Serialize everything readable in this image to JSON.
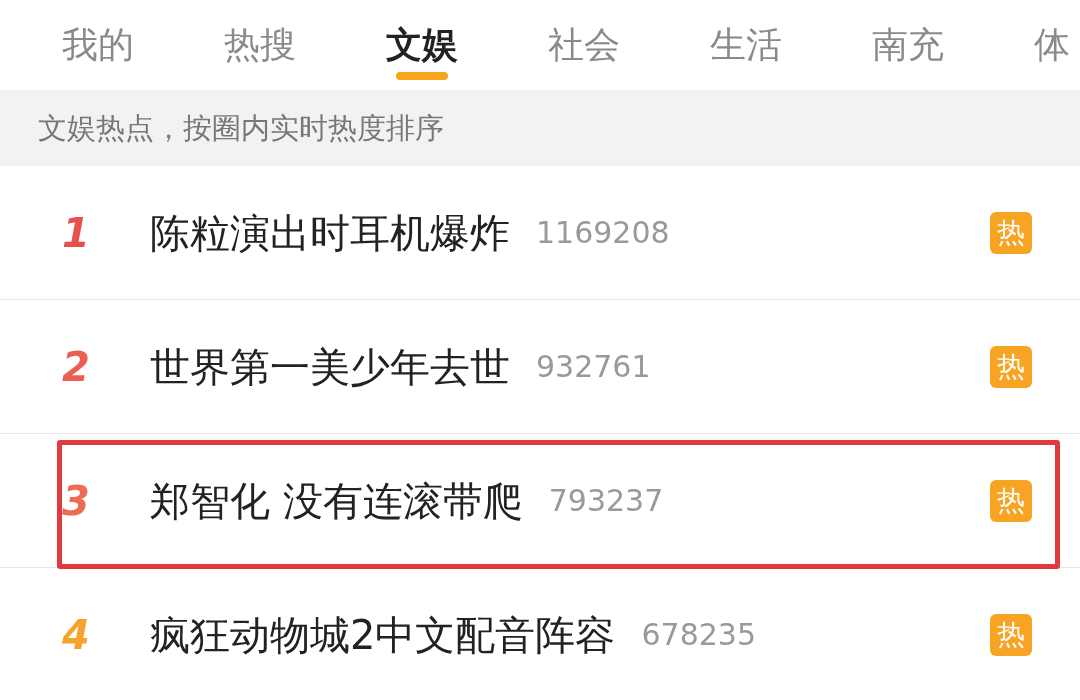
{
  "tabs": [
    {
      "label": "我的",
      "selected": false
    },
    {
      "label": "热搜",
      "selected": false
    },
    {
      "label": "文娱",
      "selected": true
    },
    {
      "label": "社会",
      "selected": false
    },
    {
      "label": "生活",
      "selected": false
    },
    {
      "label": "南充",
      "selected": false
    },
    {
      "label": "体",
      "selected": false
    }
  ],
  "banner": "文娱热点，按圈内实时热度排序",
  "items": [
    {
      "rank": "1",
      "color": "#e5524c",
      "title": "陈粒演出时耳机爆炸",
      "count": "1169208",
      "badge": {
        "kind": "hot",
        "label": "热"
      },
      "highlighted": false
    },
    {
      "rank": "2",
      "color": "#ea5f4f",
      "title": "世界第一美少年去世",
      "count": "932761",
      "badge": {
        "kind": "hot",
        "label": "热"
      },
      "highlighted": false
    },
    {
      "rank": "3",
      "color": "#ee6a52",
      "title": "郑智化 没有连滚带爬",
      "count": "793237",
      "badge": {
        "kind": "hot",
        "label": "热"
      },
      "highlighted": true
    },
    {
      "rank": "4",
      "color": "#f4a42c",
      "title": "疯狂动物城2中文配音阵容",
      "count": "678235",
      "badge": {
        "kind": "hot",
        "label": "热"
      },
      "highlighted": false
    }
  ]
}
